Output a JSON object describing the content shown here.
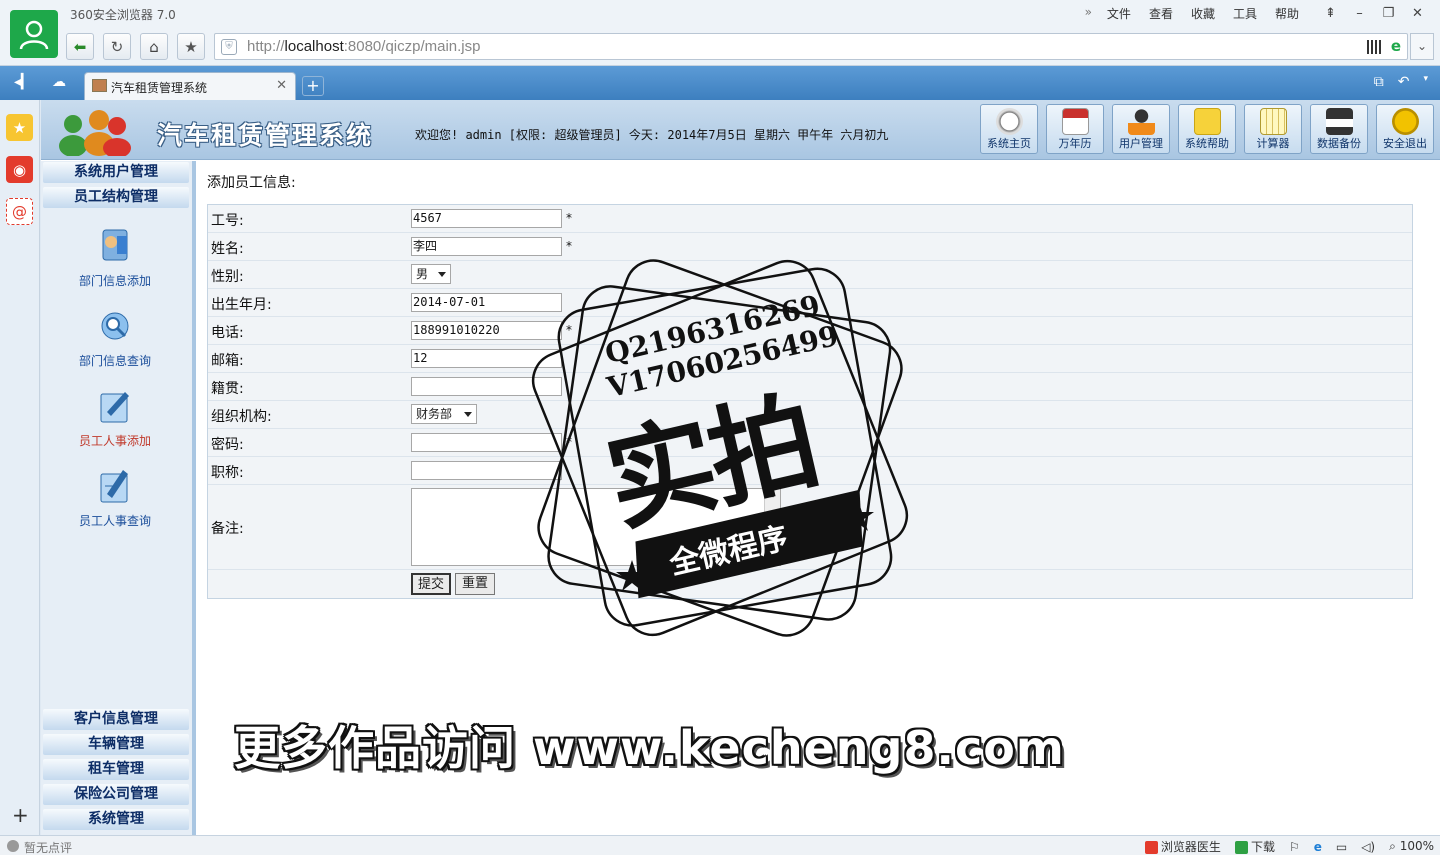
{
  "browser": {
    "title": "360安全浏览器 7.0",
    "menu": [
      "文件",
      "查看",
      "收藏",
      "工具",
      "帮助"
    ],
    "url_prefix": "http://",
    "url_host": "localhost",
    "url_rest": ":8080/qiczp/main.jsp",
    "tab_title": "汽车租赁管理系统",
    "status_left": "暂无点评",
    "status_doctor": "浏览器医生",
    "status_download": "下载",
    "zoom": "100%"
  },
  "app": {
    "title": "汽车租赁管理系统",
    "welcome": "欢迎您! admin [权限: 超级管理员] 今天: 2014年7月5日 星期六 甲午年 六月初九",
    "toolbar": [
      {
        "label": "系统主页",
        "icon": "clock-icon"
      },
      {
        "label": "万年历",
        "icon": "calendar-icon"
      },
      {
        "label": "用户管理",
        "icon": "user-icon"
      },
      {
        "label": "系统帮助",
        "icon": "notes-icon"
      },
      {
        "label": "计算器",
        "icon": "calculator-icon"
      },
      {
        "label": "数据备份",
        "icon": "floppy-disk-icon"
      },
      {
        "label": "安全退出",
        "icon": "power-icon"
      }
    ]
  },
  "nav": {
    "groups_top": [
      "系统用户管理",
      "员工结构管理"
    ],
    "items": [
      {
        "label": "部门信息添加",
        "icon": "department-add-icon"
      },
      {
        "label": "部门信息查询",
        "icon": "department-search-icon"
      },
      {
        "label": "员工人事添加",
        "icon": "staff-add-icon"
      },
      {
        "label": "员工人事查询",
        "icon": "staff-search-icon"
      }
    ],
    "groups_bottom": [
      "客户信息管理",
      "车辆管理",
      "租车管理",
      "保险公司管理",
      "系统管理"
    ]
  },
  "form": {
    "heading": "添加员工信息:",
    "fields": {
      "id": {
        "label": "工号:",
        "value": "4567"
      },
      "name": {
        "label": "姓名:",
        "value": "李四"
      },
      "gender": {
        "label": "性别:",
        "value": "男"
      },
      "birth": {
        "label": "出生年月:",
        "value": "2014-07-01"
      },
      "phone": {
        "label": "电话:",
        "value": "188991010220"
      },
      "email": {
        "label": "邮箱:",
        "value": "12"
      },
      "native": {
        "label": "籍贯:",
        "value": ""
      },
      "org": {
        "label": "组织机构:",
        "value": "财务部"
      },
      "password": {
        "label": "密码:",
        "value": ""
      },
      "title": {
        "label": "职称:",
        "value": ""
      },
      "remark": {
        "label": "备注:",
        "value": ""
      }
    },
    "required_mark": "*",
    "submit": "提交",
    "reset": "重置"
  },
  "overlay": {
    "stamp_line1": "Q2196316269",
    "stamp_line2": "V17060256499",
    "stamp_big": "实拍",
    "stamp_ribbon": "全微程序",
    "watermark": "更多作品访问 www.kecheng8.com"
  }
}
